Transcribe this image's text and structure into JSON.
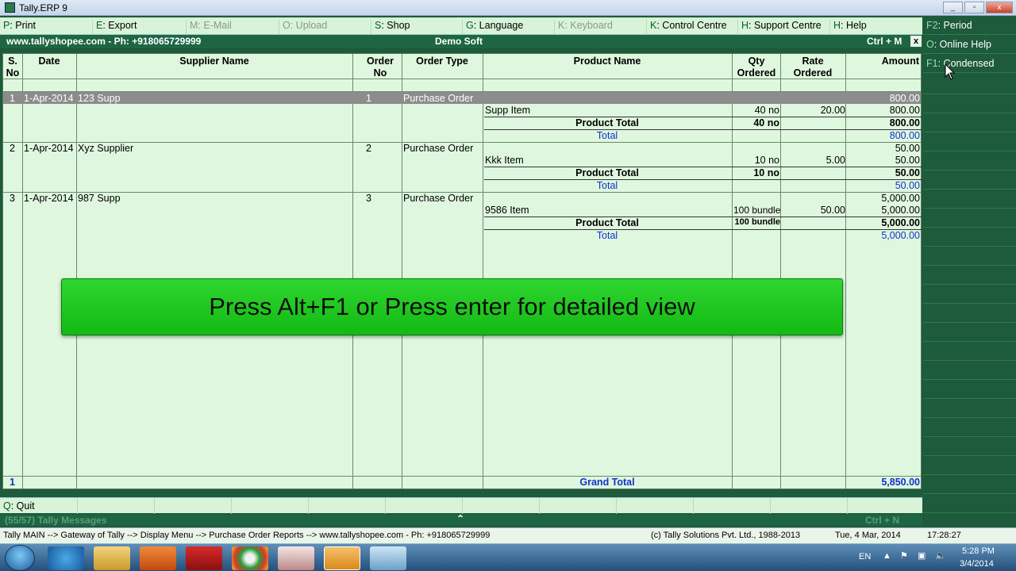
{
  "window": {
    "title": "Tally.ERP 9"
  },
  "menu": [
    {
      "key": "P",
      "label": ": Print",
      "enabled": true
    },
    {
      "key": "E",
      "label": ": Export",
      "enabled": true
    },
    {
      "key": "M",
      "label": ": E-Mail",
      "enabled": false
    },
    {
      "key": "O",
      "label": ": Upload",
      "enabled": false
    },
    {
      "key": "S",
      "label": ": Shop",
      "enabled": true
    },
    {
      "key": "G",
      "label": ": Language",
      "enabled": true
    },
    {
      "key": "K",
      "label": ": Keyboard",
      "enabled": false
    },
    {
      "key": "K",
      "label": ": Control Centre",
      "enabled": true
    },
    {
      "key": "H",
      "label": ": Support Centre",
      "enabled": true
    },
    {
      "key": "H",
      "label": ": Help",
      "enabled": true
    }
  ],
  "info": {
    "left": "www.tallyshopee.com - Ph: +918065729999",
    "company": "Demo Soft",
    "shortcut": "Ctrl + M",
    "close": "x"
  },
  "table": {
    "headers": {
      "sno": "S. No",
      "date": "Date",
      "supplier": "Supplier Name",
      "orderno": "Order No",
      "ordertype": "Order Type",
      "product": "Product Name",
      "qty": "Qty Ordered",
      "rate": "Rate Ordered",
      "amount": "Amount"
    },
    "rows": [
      {
        "sno": "1",
        "date": "1-Apr-2014",
        "supplier": "123 Supp",
        "orderno": "1",
        "ordertype": "Purchase Order",
        "amount": "800.00",
        "item": {
          "name": "Supp Item",
          "qty": "40 no",
          "rate": "20.00",
          "amount": "800.00"
        },
        "ptotal": {
          "label": "Product Total",
          "qty": "40 no",
          "amount": "800.00"
        },
        "total": {
          "label": "Total",
          "amount": "800.00"
        }
      },
      {
        "sno": "2",
        "date": "1-Apr-2014",
        "supplier": "Xyz Supplier",
        "orderno": "2",
        "ordertype": "Purchase Order",
        "amount": "50.00",
        "item": {
          "name": "Kkk Item",
          "qty": "10 no",
          "rate": "5.00",
          "amount": "50.00"
        },
        "ptotal": {
          "label": "Product Total",
          "qty": "10 no",
          "amount": "50.00"
        },
        "total": {
          "label": "Total",
          "amount": "50.00"
        }
      },
      {
        "sno": "3",
        "date": "1-Apr-2014",
        "supplier": "987 Supp",
        "orderno": "3",
        "ordertype": "Purchase Order",
        "amount": "5,000.00",
        "item": {
          "name": "9586 Item",
          "qty": "100 bundle",
          "rate": "50.00",
          "amount": "5,000.00"
        },
        "ptotal": {
          "label": "Product Total",
          "qty": "100 bundle",
          "amount": "5,000.00"
        },
        "total": {
          "label": "Total",
          "amount": "5,000.00"
        }
      }
    ],
    "footer": {
      "count": "1",
      "label": "Grand Total",
      "amount": "5,850.00"
    }
  },
  "banner": "Press Alt+F1 or Press enter for detailed view",
  "right_panel": [
    {
      "key": "F2",
      "label": ": Period"
    },
    {
      "key": "O",
      "label": ": Online Help"
    },
    {
      "key": "F1",
      "label": ": Condensed"
    }
  ],
  "bottom": {
    "quit_key": "Q",
    "quit_label": ": Quit",
    "messages": "(55/57) Tally Messages",
    "ctrl_n": "Ctrl + N"
  },
  "status": {
    "path": "Tally MAIN --> Gateway of Tally --> Display Menu --> Purchase Order Reports --> www.tallyshopee.com - Ph: +918065729999",
    "copyright": "(c) Tally Solutions Pvt. Ltd., 1988-2013",
    "date": "Tue, 4 Mar, 2014",
    "time": "17:28:27"
  },
  "taskbar": {
    "lang": "EN",
    "clock_time": "5:28 PM",
    "clock_date": "3/4/2014"
  },
  "colors": {
    "bg": "#dff7df",
    "header": "#1e6643",
    "banner": "#22c822",
    "link": "#1133cc"
  }
}
